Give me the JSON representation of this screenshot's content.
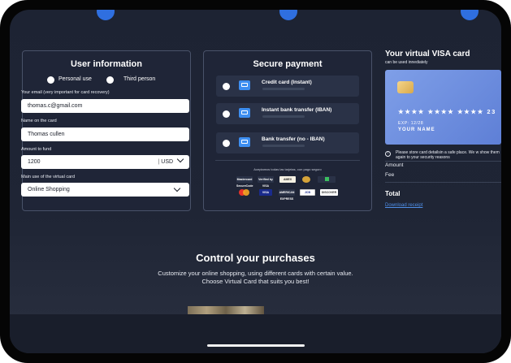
{
  "user_info": {
    "title": "User information",
    "radio_personal": "Personal use",
    "radio_third": "Third person",
    "email_label": "Your email (very important for card recovery)",
    "email_value": "thomas.c@gmail.com",
    "name_label": "Name on the card",
    "name_value": "Thomas cullen",
    "amount_label": "Amount to fund",
    "amount_value": "1200",
    "currency": "USD",
    "use_label": "Main use of the virtual card",
    "use_value": "Online Shopping"
  },
  "secure_payment": {
    "title": "Secure payment",
    "options": [
      {
        "label": "Credit card (Instant)"
      },
      {
        "label": "Instant bank transfer (IBAN)"
      },
      {
        "label": "Bank transfer (no - IBAN)"
      }
    ],
    "accepted_text": "Aceptamos todas las tarjetas, con pago seguro",
    "logos_row1": [
      "Mastercard SecureCode",
      "Verified by VISA",
      "AMEX",
      "",
      ""
    ],
    "logos_row2": [
      "",
      "VISA",
      "AMERICAN EXPRESS",
      "JCB",
      "DISCOVER"
    ]
  },
  "virtual_card": {
    "title": "Your virtual VISA card",
    "subtitle": "can be used innediately",
    "card_number": "★★★★  ★★★★  ★★★★  23",
    "expiry": "EXP: 12/28",
    "card_name": "YOUR NAME",
    "notice": "Please store card detailsin a safe place. We w show them again to your security reasons",
    "amount_label": "Amount",
    "fee_label": "Fee",
    "total_label": "Total",
    "download_label": "Download receipt"
  },
  "promo": {
    "heading": "Control your purchases",
    "line1": "Customize your online shopping, using different cards with certain value.",
    "line2": "Choose Virtual Card that suits you best!"
  },
  "colors": {
    "accent": "#2f6fe0",
    "card": "#6f8fe0",
    "background": "#1f2535"
  }
}
